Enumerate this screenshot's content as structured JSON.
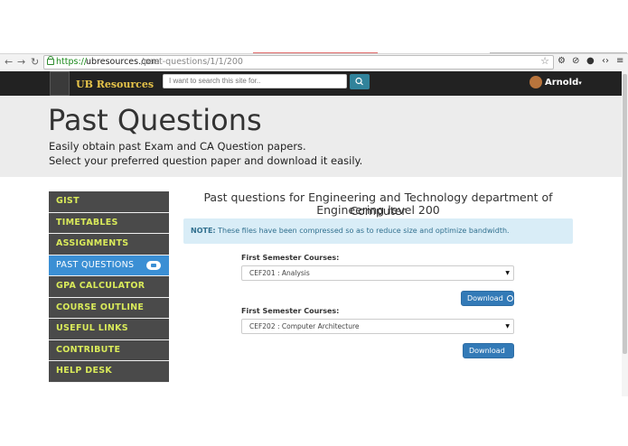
{
  "browser": {
    "url_scheme": "https://",
    "url_host": "ubresources.com",
    "url_path": "/past-questions/1/1/200"
  },
  "navbar": {
    "logo_text": "UB Resources",
    "search_placeholder": "I want to search this site for..",
    "user_name": "Arnold"
  },
  "hero": {
    "title": "Past Questions",
    "line1": "Easily obtain past Exam and CA Question papers.",
    "line2": "Select your preferred question paper and download it easily."
  },
  "sidebar": {
    "items": [
      {
        "label": "GIST"
      },
      {
        "label": "TIMETABLES"
      },
      {
        "label": "ASSIGNMENTS"
      },
      {
        "label": "PAST QUESTIONS"
      },
      {
        "label": "GPA CALCULATOR"
      },
      {
        "label": "COURSE OUTLINE"
      },
      {
        "label": "USEFUL LINKS"
      },
      {
        "label": "CONTRIBUTE"
      },
      {
        "label": "HELP DESK"
      }
    ]
  },
  "main": {
    "title_line1": "Past questions for Engineering and Technology department of Computer",
    "title_line2": "Engineering level 200",
    "note_label": "NOTE:",
    "note_text": " These files have been compressed so as to reduce size and optimize bandwidth.",
    "sections": [
      {
        "label": "First Semester Courses:",
        "selected": "CEF201 : Analysis",
        "button": "Download"
      },
      {
        "label": "First Semester Courses:",
        "selected": "CEF202 : Computer Architecture",
        "button": "Download"
      }
    ]
  },
  "colors": {
    "navbar_bg": "#222222",
    "sidebar_bg": "#4a4a4a",
    "sidebar_text": "#d9ea5a",
    "active_item": "#3b8fd4",
    "button": "#337ab7",
    "note_bg": "#d9edf7"
  }
}
